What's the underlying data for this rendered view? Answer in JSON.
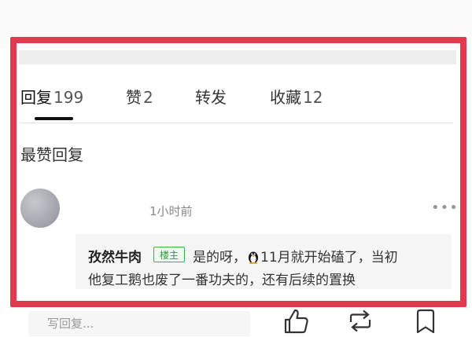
{
  "tabs": [
    {
      "label": "回复",
      "count": "199"
    },
    {
      "label": "赞",
      "count": "2"
    },
    {
      "label": "转发",
      "count": ""
    },
    {
      "label": "收藏",
      "count": "12"
    }
  ],
  "section_title": "最赞回复",
  "comment": {
    "time": "1小时前",
    "more": "•••",
    "author": "孜然牛肉",
    "op_badge": "楼主",
    "text_line1_a": "是的呀，",
    "text_line1_b": "11月就开始磕了，当初",
    "text_line2": "他复工鹅也废了一番功夫的，还有后续的置换",
    "emoji": "penguin-icon"
  },
  "bottom_bar": {
    "reply_placeholder": "写回复...",
    "actions": [
      "like-icon",
      "repost-icon",
      "bookmark-icon"
    ]
  },
  "colors": {
    "highlight_frame": "#e23a4c",
    "op_badge": "#39b54a",
    "tab_active_underline": "#111111"
  }
}
